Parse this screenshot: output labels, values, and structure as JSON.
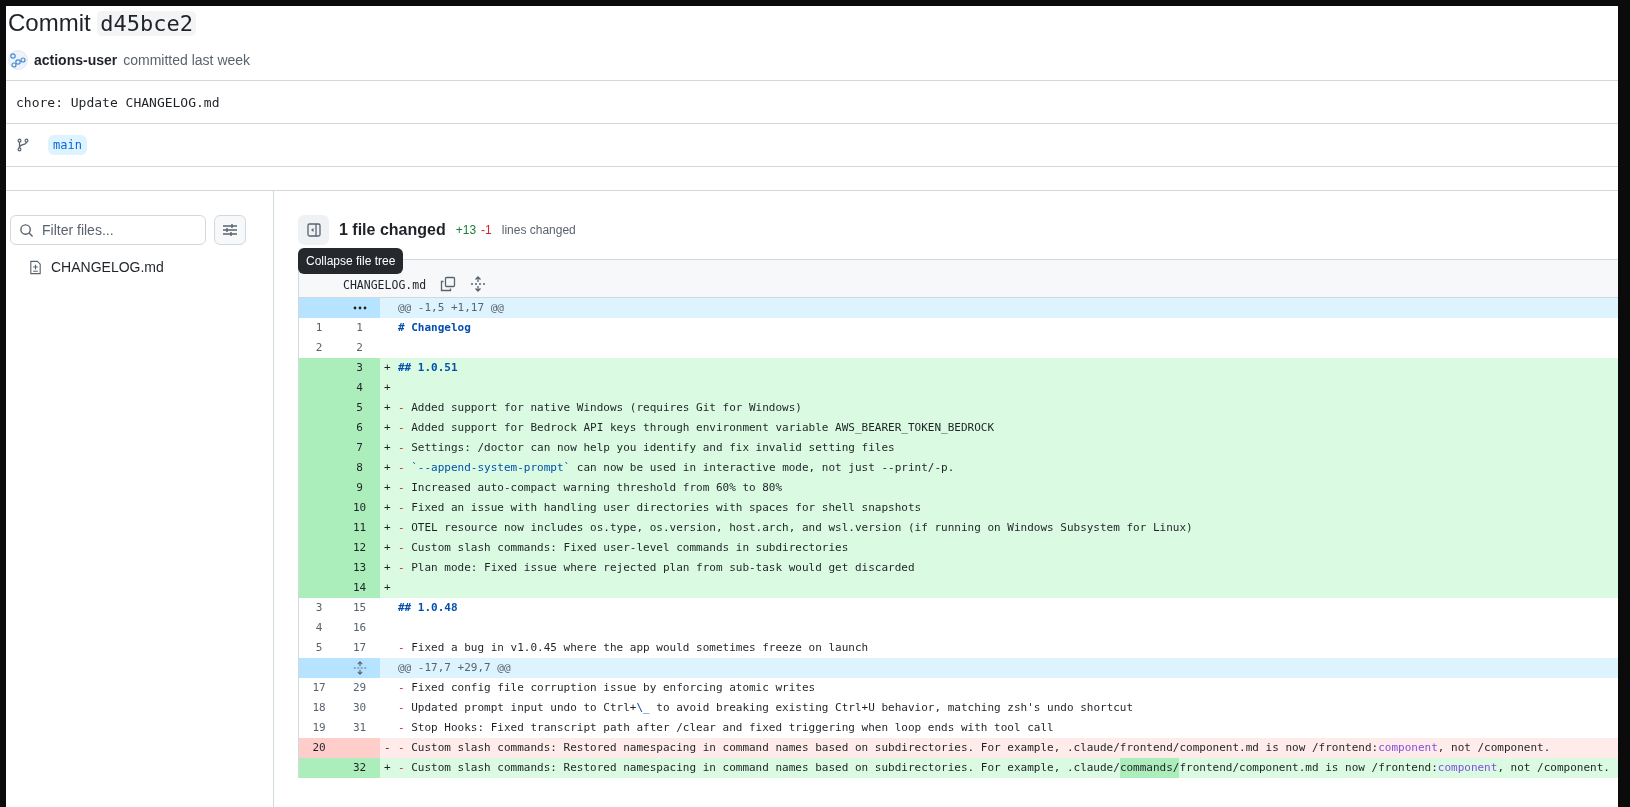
{
  "commit": {
    "title": "Commit",
    "sha": "d45bce2",
    "author": "actions-user",
    "action": "committed last week",
    "message": "chore: Update CHANGELOG.md",
    "branch": "main"
  },
  "file_tree": {
    "filter_placeholder": "Filter files...",
    "files": [
      {
        "name": "CHANGELOG.md"
      }
    ]
  },
  "diff": {
    "summary": "1 file changed",
    "additions": "+13",
    "deletions": "-1",
    "summary_suffix": "lines changed",
    "tooltip": "Collapse file tree",
    "file": {
      "name": "CHANGELOG.md"
    },
    "lines": [
      {
        "kind": "hunk",
        "expander": {
          "kind": "ellipsis"
        },
        "text": "@@ -1,5 +1,17 @@"
      },
      {
        "kind": "context",
        "old": "1",
        "new": "1",
        "code": [
          {
            "kind": "heading",
            "t": "# Changelog"
          }
        ]
      },
      {
        "kind": "context",
        "old": "2",
        "new": "2"
      },
      {
        "kind": "added",
        "new": "3",
        "marker": "+",
        "code": [
          {
            "kind": "heading",
            "t": "## 1.0.51"
          }
        ]
      },
      {
        "kind": "added",
        "new": "4",
        "marker": "+"
      },
      {
        "kind": "added",
        "new": "5",
        "marker": "+",
        "code": [
          {
            "kind": "bullet",
            "t": "-"
          },
          {
            "kind": "plain",
            "t": " Added support for native Windows (requires Git for Windows)"
          }
        ]
      },
      {
        "kind": "added",
        "new": "6",
        "marker": "+",
        "code": [
          {
            "kind": "bullet",
            "t": "-"
          },
          {
            "kind": "plain",
            "t": " Added support for Bedrock API keys through environment variable AWS_BEARER_TOKEN_BEDROCK"
          }
        ]
      },
      {
        "kind": "added",
        "new": "7",
        "marker": "+",
        "code": [
          {
            "kind": "bullet",
            "t": "-"
          },
          {
            "kind": "plain",
            "t": " Settings: /doctor can now help you identify and fix invalid setting files"
          }
        ]
      },
      {
        "kind": "added",
        "new": "8",
        "marker": "+",
        "code": [
          {
            "kind": "bullet",
            "t": "-"
          },
          {
            "kind": "string",
            "t": " `--append-system-prompt`"
          },
          {
            "kind": "plain",
            "t": " can now be used in interactive mode, not just --print/-p."
          }
        ]
      },
      {
        "kind": "added",
        "new": "9",
        "marker": "+",
        "code": [
          {
            "kind": "bullet",
            "t": "-"
          },
          {
            "kind": "plain",
            "t": " Increased auto-compact warning threshold from 60% to 80%"
          }
        ]
      },
      {
        "kind": "added",
        "new": "10",
        "marker": "+",
        "code": [
          {
            "kind": "bullet",
            "t": "-"
          },
          {
            "kind": "plain",
            "t": " Fixed an issue with handling user directories with spaces for shell snapshots"
          }
        ]
      },
      {
        "kind": "added",
        "new": "11",
        "marker": "+",
        "code": [
          {
            "kind": "bullet",
            "t": "-"
          },
          {
            "kind": "plain",
            "t": " OTEL resource now includes os.type, os.version, host.arch, and wsl.version (if running on Windows Subsystem for Linux)"
          }
        ]
      },
      {
        "kind": "added",
        "new": "12",
        "marker": "+",
        "code": [
          {
            "kind": "bullet",
            "t": "-"
          },
          {
            "kind": "plain",
            "t": " Custom slash commands: Fixed user-level commands in subdirectories"
          }
        ]
      },
      {
        "kind": "added",
        "new": "13",
        "marker": "+",
        "code": [
          {
            "kind": "bullet",
            "t": "-"
          },
          {
            "kind": "plain",
            "t": " Plan mode: Fixed issue where rejected plan from sub-task would get discarded"
          }
        ]
      },
      {
        "kind": "added",
        "new": "14",
        "marker": "+"
      },
      {
        "kind": "context",
        "old": "3",
        "new": "15",
        "code": [
          {
            "kind": "heading",
            "t": "## 1.0.48"
          }
        ]
      },
      {
        "kind": "context",
        "old": "4",
        "new": "16"
      },
      {
        "kind": "context",
        "old": "5",
        "new": "17",
        "code": [
          {
            "kind": "bullet",
            "t": "-"
          },
          {
            "kind": "plain",
            "t": " Fixed a bug in v1.0.45 where the app would sometimes freeze on launch"
          }
        ]
      },
      {
        "kind": "hunk",
        "expander": {
          "kind": "unfold"
        },
        "text": "@@ -17,7 +29,7 @@"
      },
      {
        "kind": "context",
        "old": "17",
        "new": "29",
        "code": [
          {
            "kind": "bullet",
            "t": "-"
          },
          {
            "kind": "plain",
            "t": " Fixed config file corruption issue by enforcing atomic writes"
          }
        ]
      },
      {
        "kind": "context",
        "old": "18",
        "new": "30",
        "code": [
          {
            "kind": "bullet",
            "t": "-"
          },
          {
            "kind": "plain",
            "t": " Updated prompt input undo to Ctrl+"
          },
          {
            "kind": "string",
            "t": "\\_"
          },
          {
            "kind": "plain",
            "t": " to avoid breaking existing Ctrl+U behavior, matching zsh's undo shortcut"
          }
        ]
      },
      {
        "kind": "context",
        "old": "19",
        "new": "31",
        "code": [
          {
            "kind": "bullet",
            "t": "-"
          },
          {
            "kind": "plain",
            "t": " Stop Hooks: Fixed transcript path after /clear and fixed triggering when loop ends with tool call"
          }
        ]
      },
      {
        "kind": "deleted",
        "old": "20",
        "marker": "-",
        "code": [
          {
            "kind": "bullet",
            "t": "-"
          },
          {
            "kind": "plain",
            "t": " Custom slash commands: Restored namespacing in command names based on subdirectories. For example, .claude/frontend/component.md is now /frontend:"
          },
          {
            "kind": "keyword",
            "t": "component"
          },
          {
            "kind": "plain",
            "t": ", not /component."
          }
        ]
      },
      {
        "kind": "added",
        "new": "32",
        "marker": "+",
        "code": [
          {
            "kind": "bullet",
            "t": "-"
          },
          {
            "kind": "plain",
            "t": " Custom slash commands: Restored namespacing in command names based on subdirectories. For example, .claude/"
          },
          {
            "kind": "highlight",
            "t": "commands/"
          },
          {
            "kind": "plain",
            "t": "frontend/component.md is now /frontend:"
          },
          {
            "kind": "keyword",
            "t": "component"
          },
          {
            "kind": "plain",
            "t": ", not /component."
          }
        ]
      }
    ]
  }
}
